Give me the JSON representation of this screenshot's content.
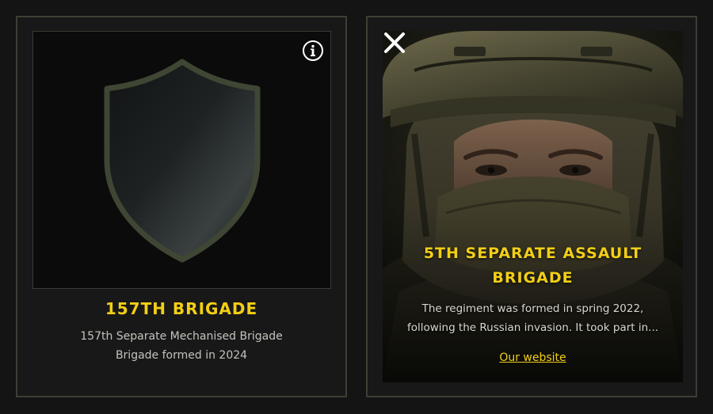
{
  "cards": [
    {
      "title": "157TH BRIGADE",
      "subtitle_lines": [
        "157th Separate Mechanised Brigade",
        "Brigade formed in 2024"
      ],
      "icon": "info-icon"
    },
    {
      "title": "5TH SEPARATE ASSAULT BRIGADE",
      "description_lines": [
        "The regiment was formed in spring 2022,",
        "following the Russian invasion. It took part in..."
      ],
      "link_label": "Our website",
      "icon": "close-icon"
    }
  ],
  "colors": {
    "accent": "#f2cf16",
    "background": "#141414",
    "card_border": "#3c3f35",
    "shield_outline": "#3f4634"
  }
}
